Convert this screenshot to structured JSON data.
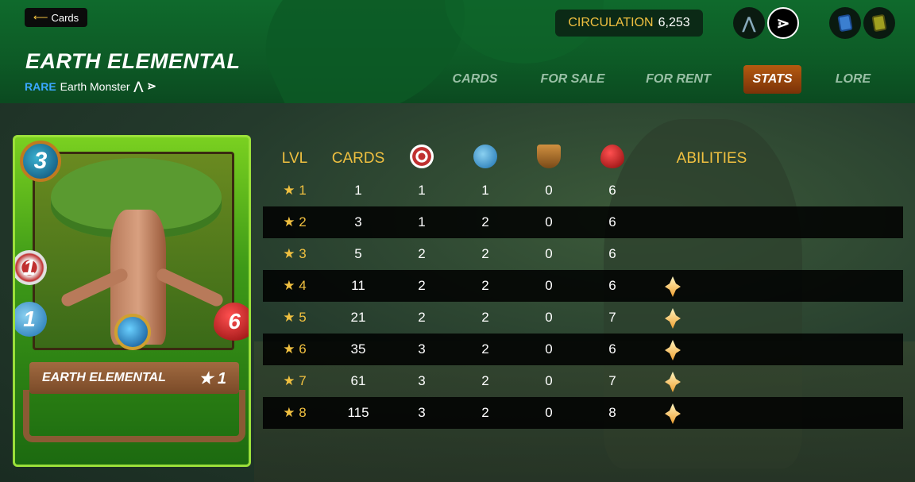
{
  "nav": {
    "back_label": "Cards",
    "back_icon": "arrow-left-icon"
  },
  "header": {
    "title": "EARTH ELEMENTAL",
    "rarity": "RARE",
    "type_label": "Earth Monster",
    "circulation_label": "CIRCULATION",
    "circulation_value": "6,253"
  },
  "tabs": [
    {
      "label": "CARDS",
      "active": false
    },
    {
      "label": "FOR SALE",
      "active": false
    },
    {
      "label": "FOR RENT",
      "active": false
    },
    {
      "label": "STATS",
      "active": true
    },
    {
      "label": "LORE",
      "active": false
    }
  ],
  "card": {
    "name": "EARTH ELEMENTAL",
    "mana": "3",
    "attack": "1",
    "ranged": "1",
    "health": "6",
    "level_stars": "★ 1"
  },
  "table": {
    "headers": {
      "lvl": "LVL",
      "cards": "CARDS",
      "attack_icon": "target-icon",
      "ranged_icon": "bow-icon",
      "armor_icon": "shield-icon",
      "health_icon": "heart-icon",
      "abilities": "ABILITIES"
    },
    "rows": [
      {
        "lvl": "★ 1",
        "cards": "1",
        "atk": "1",
        "rng": "1",
        "arm": "0",
        "hp": "6",
        "ability": false
      },
      {
        "lvl": "★ 2",
        "cards": "3",
        "atk": "1",
        "rng": "2",
        "arm": "0",
        "hp": "6",
        "ability": false
      },
      {
        "lvl": "★ 3",
        "cards": "5",
        "atk": "2",
        "rng": "2",
        "arm": "0",
        "hp": "6",
        "ability": false
      },
      {
        "lvl": "★ 4",
        "cards": "11",
        "atk": "2",
        "rng": "2",
        "arm": "0",
        "hp": "6",
        "ability": true
      },
      {
        "lvl": "★ 5",
        "cards": "21",
        "atk": "2",
        "rng": "2",
        "arm": "0",
        "hp": "7",
        "ability": true
      },
      {
        "lvl": "★ 6",
        "cards": "35",
        "atk": "3",
        "rng": "2",
        "arm": "0",
        "hp": "6",
        "ability": true
      },
      {
        "lvl": "★ 7",
        "cards": "61",
        "atk": "3",
        "rng": "2",
        "arm": "0",
        "hp": "7",
        "ability": true
      },
      {
        "lvl": "★ 8",
        "cards": "115",
        "atk": "3",
        "rng": "2",
        "arm": "0",
        "hp": "8",
        "ability": true
      }
    ]
  },
  "colors": {
    "accent": "#f0c040",
    "rarity": "#3aa8ff",
    "active_tab": "#9a4a10"
  }
}
